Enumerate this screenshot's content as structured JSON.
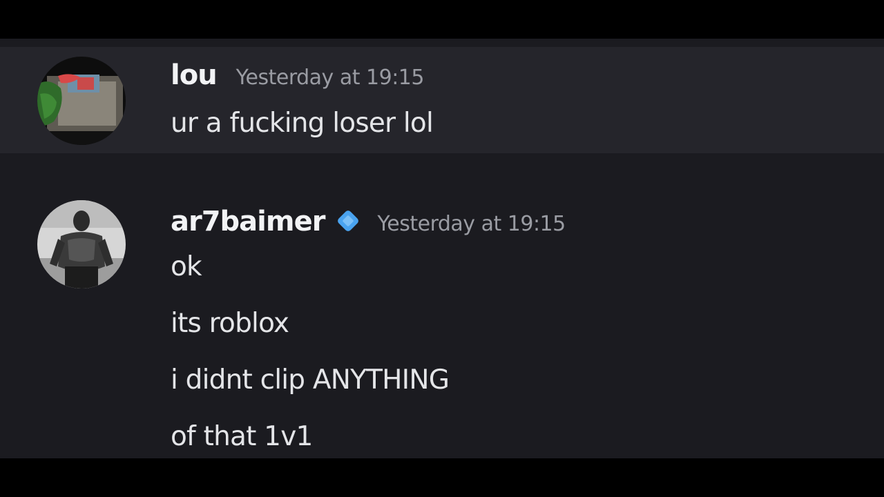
{
  "messages": [
    {
      "author": "lou",
      "timestamp": "Yesterday at 19:15",
      "avatar_icon": "user-avatar-photo",
      "lines": [
        "ur a fucking loser lol"
      ]
    },
    {
      "author": "ar7baimer",
      "timestamp": "Yesterday at 19:15",
      "avatar_icon": "user-avatar-photo",
      "badge_icon": "diamond-badge-icon",
      "lines": [
        "ok",
        "its roblox",
        "i didnt clip ANYTHING",
        "of that 1v1"
      ]
    }
  ],
  "colors": {
    "background": "#1b1b20",
    "highlight": "#25252b",
    "username": "#f2f3f5",
    "timestamp": "#9a9ca3",
    "message_text": "#e4e5e8",
    "badge": "#4aa3ef"
  }
}
